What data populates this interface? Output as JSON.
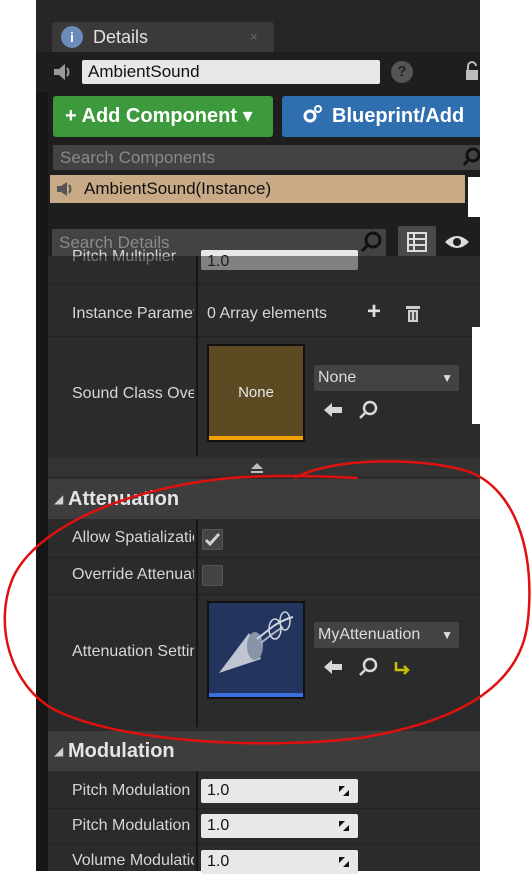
{
  "tab": {
    "title": "Details",
    "close_glyph": "×"
  },
  "name_field": {
    "value": "AmbientSound"
  },
  "help_glyph": "?",
  "buttons": {
    "add_component": "+ Add Component ▾",
    "blueprint": "Blueprint/Add"
  },
  "search_components": {
    "placeholder": "Search Components"
  },
  "component_row": {
    "label": "AmbientSound(Instance)"
  },
  "search_details": {
    "placeholder": "Search Details"
  },
  "sound": {
    "pitch_multiplier_label": "Pitch Multiplier",
    "pitch_multiplier_value": "1.0",
    "instance_params_label": "Instance Parameters",
    "instance_params_value": "0 Array elements",
    "sound_class_label": "Sound Class Override",
    "sound_class_thumb": "None",
    "sound_class_dropdown": "None"
  },
  "attenuation": {
    "header": "Attenuation",
    "allow_spatialization_label": "Allow Spatialization",
    "allow_spatialization_checked": true,
    "override_attenuation_label": "Override Attenuation",
    "override_attenuation_checked": false,
    "settings_label": "Attenuation Settings",
    "settings_value": "MyAttenuation"
  },
  "modulation": {
    "header": "Modulation",
    "rows": [
      {
        "label": "Pitch Modulation Min",
        "value": "1.0"
      },
      {
        "label": "Pitch Modulation Max",
        "value": "1.0"
      },
      {
        "label": "Volume Modulation Min",
        "value": "1.0"
      }
    ]
  },
  "icons": {
    "info": "info-icon",
    "help": "help-icon",
    "lock": "lock-icon",
    "sound": "speaker-icon",
    "search": "search-icon",
    "grid": "grid-icon",
    "eye": "eye-icon",
    "add": "plus-icon",
    "delete": "trash-icon",
    "use_selected": "arrow-left-icon",
    "browse": "magnifier-icon",
    "reset": "reset-arrow-icon",
    "reset_to_default": "reset-to-default-icon"
  },
  "colors": {
    "add_component_button": "#3c9a3c",
    "blueprint_button": "#2f6fb0",
    "selected_row": "#c8aa86",
    "sound_class_thumb_bar": "#f0a000",
    "attenuation_thumb_bar": "#3a6fe0",
    "annotation_circle": "#e01010"
  }
}
